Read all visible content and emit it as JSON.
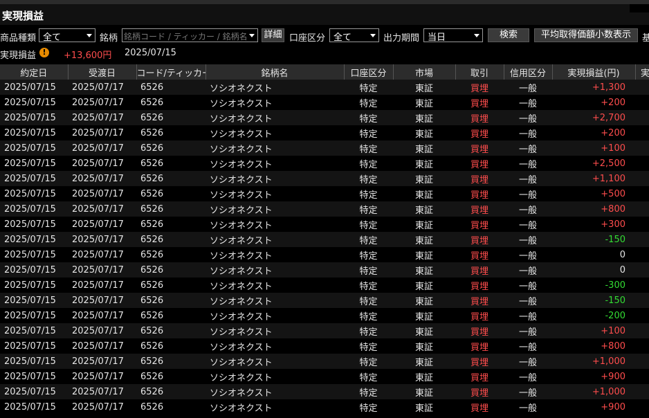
{
  "title": "実現損益",
  "filters": {
    "product_label": "商品種類",
    "product_value": "全て",
    "stock_label": "銘柄",
    "stock_placeholder": "銘柄コード / ティッカー / 銘柄名",
    "detail_button": "詳細",
    "account_label": "口座区分",
    "account_value": "全て",
    "period_label": "出力期間",
    "period_value": "当日",
    "search_button": "検索",
    "avg_button": "平均取得価額小数表示",
    "cut_label": "基"
  },
  "summary": {
    "label": "実現損益",
    "warning_icon": "warning-icon",
    "total": "+13,600円",
    "date": "2025/07/15"
  },
  "table": {
    "headers": [
      "約定日",
      "受渡日",
      "コード/ティッカー",
      "銘柄名",
      "口座区分",
      "市場",
      "取引",
      "信用区分",
      "実現損益(円)",
      "実現"
    ],
    "rows": [
      {
        "trade_date": "2025/07/15",
        "settle_date": "2025/07/17",
        "code": "6526",
        "name": "ソシオネクスト",
        "account": "特定",
        "market": "東証",
        "trade": "買埋",
        "credit": "一般",
        "pl": "+1,300",
        "sign": "pos"
      },
      {
        "trade_date": "2025/07/15",
        "settle_date": "2025/07/17",
        "code": "6526",
        "name": "ソシオネクスト",
        "account": "特定",
        "market": "東証",
        "trade": "買埋",
        "credit": "一般",
        "pl": "+200",
        "sign": "pos"
      },
      {
        "trade_date": "2025/07/15",
        "settle_date": "2025/07/17",
        "code": "6526",
        "name": "ソシオネクスト",
        "account": "特定",
        "market": "東証",
        "trade": "買埋",
        "credit": "一般",
        "pl": "+2,700",
        "sign": "pos"
      },
      {
        "trade_date": "2025/07/15",
        "settle_date": "2025/07/17",
        "code": "6526",
        "name": "ソシオネクスト",
        "account": "特定",
        "market": "東証",
        "trade": "買埋",
        "credit": "一般",
        "pl": "+200",
        "sign": "pos"
      },
      {
        "trade_date": "2025/07/15",
        "settle_date": "2025/07/17",
        "code": "6526",
        "name": "ソシオネクスト",
        "account": "特定",
        "market": "東証",
        "trade": "買埋",
        "credit": "一般",
        "pl": "+100",
        "sign": "pos"
      },
      {
        "trade_date": "2025/07/15",
        "settle_date": "2025/07/17",
        "code": "6526",
        "name": "ソシオネクスト",
        "account": "特定",
        "market": "東証",
        "trade": "買埋",
        "credit": "一般",
        "pl": "+2,500",
        "sign": "pos"
      },
      {
        "trade_date": "2025/07/15",
        "settle_date": "2025/07/17",
        "code": "6526",
        "name": "ソシオネクスト",
        "account": "特定",
        "market": "東証",
        "trade": "買埋",
        "credit": "一般",
        "pl": "+1,100",
        "sign": "pos"
      },
      {
        "trade_date": "2025/07/15",
        "settle_date": "2025/07/17",
        "code": "6526",
        "name": "ソシオネクスト",
        "account": "特定",
        "market": "東証",
        "trade": "買埋",
        "credit": "一般",
        "pl": "+500",
        "sign": "pos"
      },
      {
        "trade_date": "2025/07/15",
        "settle_date": "2025/07/17",
        "code": "6526",
        "name": "ソシオネクスト",
        "account": "特定",
        "market": "東証",
        "trade": "買埋",
        "credit": "一般",
        "pl": "+800",
        "sign": "pos"
      },
      {
        "trade_date": "2025/07/15",
        "settle_date": "2025/07/17",
        "code": "6526",
        "name": "ソシオネクスト",
        "account": "特定",
        "market": "東証",
        "trade": "買埋",
        "credit": "一般",
        "pl": "+300",
        "sign": "pos"
      },
      {
        "trade_date": "2025/07/15",
        "settle_date": "2025/07/17",
        "code": "6526",
        "name": "ソシオネクスト",
        "account": "特定",
        "market": "東証",
        "trade": "買埋",
        "credit": "一般",
        "pl": "-150",
        "sign": "neg"
      },
      {
        "trade_date": "2025/07/15",
        "settle_date": "2025/07/17",
        "code": "6526",
        "name": "ソシオネクスト",
        "account": "特定",
        "market": "東証",
        "trade": "買埋",
        "credit": "一般",
        "pl": "0",
        "sign": "zero"
      },
      {
        "trade_date": "2025/07/15",
        "settle_date": "2025/07/17",
        "code": "6526",
        "name": "ソシオネクスト",
        "account": "特定",
        "market": "東証",
        "trade": "買埋",
        "credit": "一般",
        "pl": "0",
        "sign": "zero"
      },
      {
        "trade_date": "2025/07/15",
        "settle_date": "2025/07/17",
        "code": "6526",
        "name": "ソシオネクスト",
        "account": "特定",
        "market": "東証",
        "trade": "買埋",
        "credit": "一般",
        "pl": "-300",
        "sign": "neg"
      },
      {
        "trade_date": "2025/07/15",
        "settle_date": "2025/07/17",
        "code": "6526",
        "name": "ソシオネクスト",
        "account": "特定",
        "market": "東証",
        "trade": "買埋",
        "credit": "一般",
        "pl": "-150",
        "sign": "neg"
      },
      {
        "trade_date": "2025/07/15",
        "settle_date": "2025/07/17",
        "code": "6526",
        "name": "ソシオネクスト",
        "account": "特定",
        "market": "東証",
        "trade": "買埋",
        "credit": "一般",
        "pl": "-200",
        "sign": "neg"
      },
      {
        "trade_date": "2025/07/15",
        "settle_date": "2025/07/17",
        "code": "6526",
        "name": "ソシオネクスト",
        "account": "特定",
        "market": "東証",
        "trade": "買埋",
        "credit": "一般",
        "pl": "+100",
        "sign": "pos"
      },
      {
        "trade_date": "2025/07/15",
        "settle_date": "2025/07/17",
        "code": "6526",
        "name": "ソシオネクスト",
        "account": "特定",
        "market": "東証",
        "trade": "買埋",
        "credit": "一般",
        "pl": "+800",
        "sign": "pos"
      },
      {
        "trade_date": "2025/07/15",
        "settle_date": "2025/07/17",
        "code": "6526",
        "name": "ソシオネクスト",
        "account": "特定",
        "market": "東証",
        "trade": "買埋",
        "credit": "一般",
        "pl": "+1,000",
        "sign": "pos"
      },
      {
        "trade_date": "2025/07/15",
        "settle_date": "2025/07/17",
        "code": "6526",
        "name": "ソシオネクスト",
        "account": "特定",
        "market": "東証",
        "trade": "買埋",
        "credit": "一般",
        "pl": "+900",
        "sign": "pos"
      },
      {
        "trade_date": "2025/07/15",
        "settle_date": "2025/07/17",
        "code": "6526",
        "name": "ソシオネクスト",
        "account": "特定",
        "market": "東証",
        "trade": "買埋",
        "credit": "一般",
        "pl": "+1,000",
        "sign": "pos"
      },
      {
        "trade_date": "2025/07/15",
        "settle_date": "2025/07/17",
        "code": "6526",
        "name": "ソシオネクスト",
        "account": "特定",
        "market": "東証",
        "trade": "買埋",
        "credit": "一般",
        "pl": "+900",
        "sign": "pos"
      }
    ]
  },
  "colors": {
    "background": "#000000",
    "positive": "#ff4d4d",
    "negative": "#33dd33",
    "header_bg": "#2c2c2c",
    "warning": "#e88b00"
  }
}
